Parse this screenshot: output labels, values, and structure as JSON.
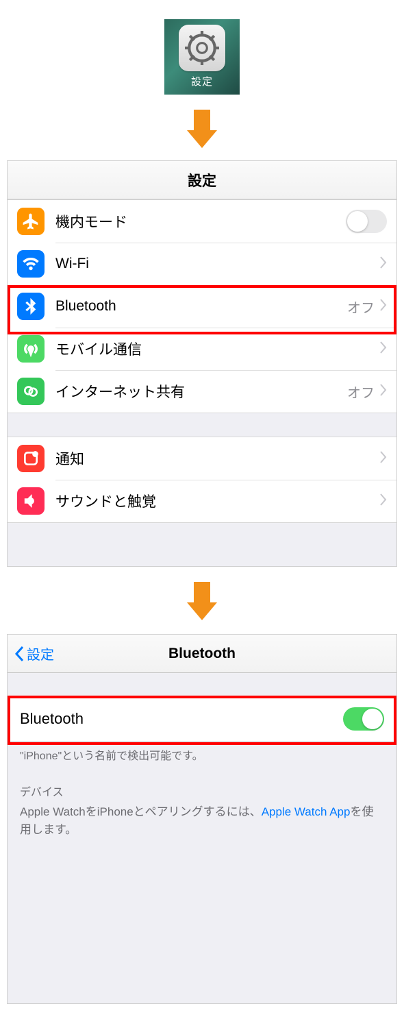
{
  "app_icon": {
    "label": "設定"
  },
  "settings_screen": {
    "title": "設定",
    "rows": {
      "airplane": {
        "label": "機内モード"
      },
      "wifi": {
        "label": "Wi-Fi"
      },
      "bluetooth": {
        "label": "Bluetooth",
        "detail": "オフ"
      },
      "cellular": {
        "label": "モバイル通信"
      },
      "hotspot": {
        "label": "インターネット共有",
        "detail": "オフ"
      },
      "notifications": {
        "label": "通知"
      },
      "sounds": {
        "label": "サウンドと触覚"
      }
    }
  },
  "bluetooth_screen": {
    "back_label": "設定",
    "title": "Bluetooth",
    "toggle_label": "Bluetooth",
    "discoverable_text": "\"iPhone\"という名前で検出可能です。",
    "devices_header": "デバイス",
    "pair_text_prefix": "Apple WatchをiPhoneとペアリングするには、",
    "pair_link": "Apple Watch App",
    "pair_text_suffix": "を使用します。"
  }
}
